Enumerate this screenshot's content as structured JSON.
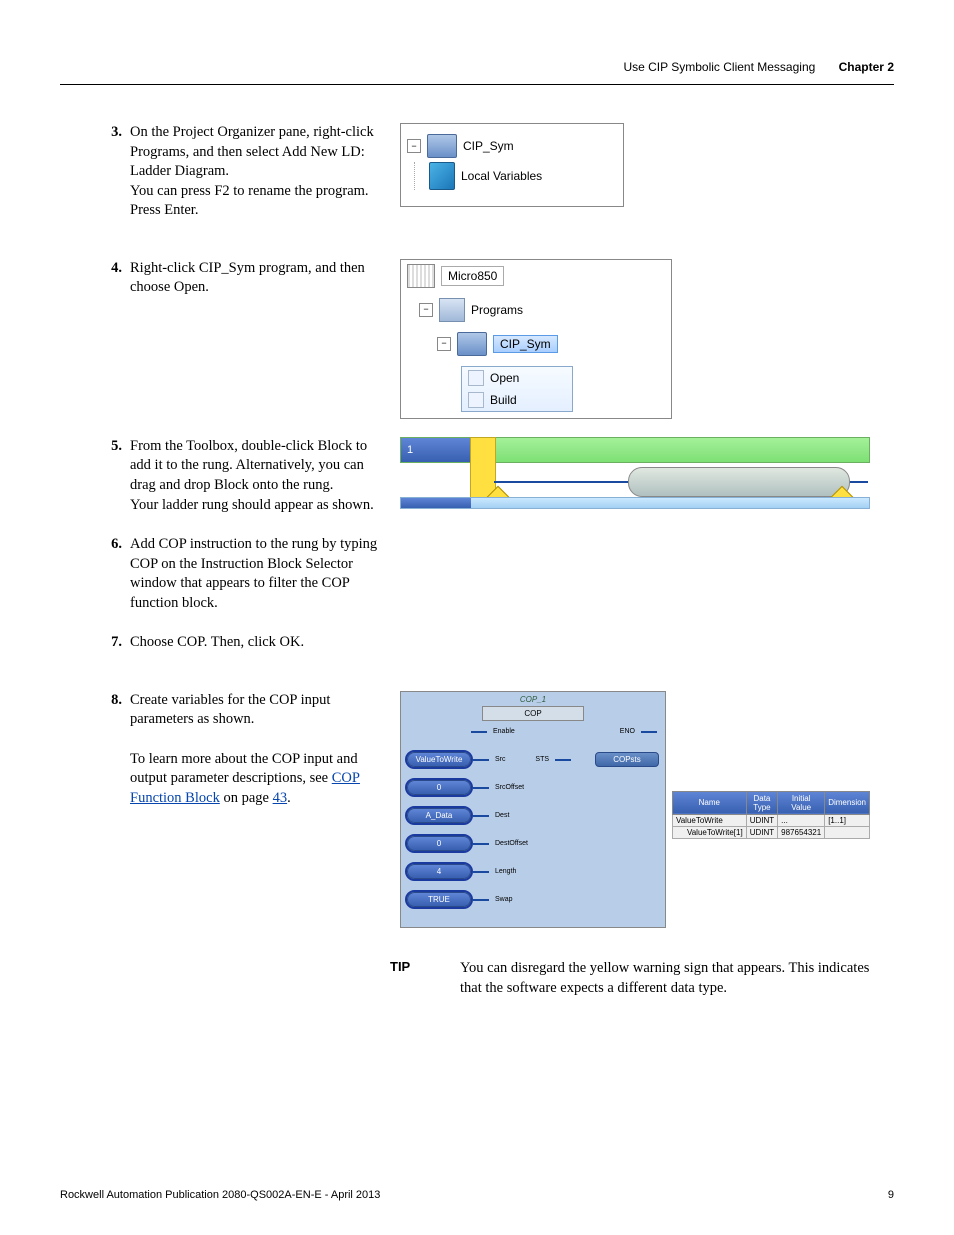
{
  "header": {
    "topic": "Use CIP Symbolic Client Messaging",
    "chapter": "Chapter 2"
  },
  "steps": {
    "s3": {
      "num": "3.",
      "text": "On the Project Organizer pane, right-click Programs, and then select Add New LD: Ladder Diagram.",
      "text2": "You can press F2 to rename the program. Press Enter."
    },
    "s4": {
      "num": "4.",
      "text": "Right-click CIP_Sym program, and then choose Open."
    },
    "s5": {
      "num": "5.",
      "text": "From the Toolbox, double-click Block to add it to the rung. Alternatively, you can drag and drop Block onto the rung.",
      "text2": "Your ladder rung should appear as shown."
    },
    "s6": {
      "num": "6.",
      "text": "Add COP instruction to the rung by typing COP on the Instruction Block Selector window that appears to filter the COP function block."
    },
    "s7": {
      "num": "7.",
      "text": "Choose COP. Then, click OK."
    },
    "s8": {
      "num": "8.",
      "text": "Create variables for the COP input parameters as shown.",
      "text2a": "To learn more about the COP input and output parameter descriptions, see ",
      "link": "COP Function Block",
      "text2b": " on page ",
      "pageref": "43",
      "text2c": "."
    }
  },
  "fig1": {
    "program": "CIP_Sym",
    "localvars": "Local Variables"
  },
  "fig2": {
    "controller": "Micro850",
    "programs": "Programs",
    "program": "CIP_Sym",
    "menu_open": "Open",
    "menu_build": "Build"
  },
  "fig3": {
    "rung": "1"
  },
  "fig4": {
    "block_name": "COP_1",
    "block_type": "COP",
    "inputs": {
      "enable": "Enable",
      "src": "Src",
      "srcoffset": "SrcOffset",
      "dest": "Dest",
      "destoffset": "DestOffset",
      "length": "Length",
      "swap": "Swap"
    },
    "outputs": {
      "eno": "ENO",
      "sts": "STS"
    },
    "pills": {
      "valuewrite": "ValueToWrite",
      "zero": "0",
      "adata": "A_Data",
      "four": "4",
      "true": "TRUE",
      "copsts": "COPsts"
    },
    "table": {
      "h_name": "Name",
      "h_type": "Data Type",
      "h_init": "Initial Value",
      "h_dim": "Dimension",
      "r1": {
        "name": "ValueToWrite",
        "type": "UDINT",
        "init": "...",
        "dim": "[1..1]"
      },
      "r2": {
        "name": "ValueToWrite[1]",
        "type": "UDINT",
        "init": "987654321",
        "dim": ""
      }
    }
  },
  "tip": {
    "label": "TIP",
    "text": "You can disregard the yellow warning sign that appears. This indicates that the software expects a different data type."
  },
  "footer": {
    "pub": "Rockwell Automation Publication 2080-QS002A-EN-E - April 2013",
    "page": "9"
  }
}
